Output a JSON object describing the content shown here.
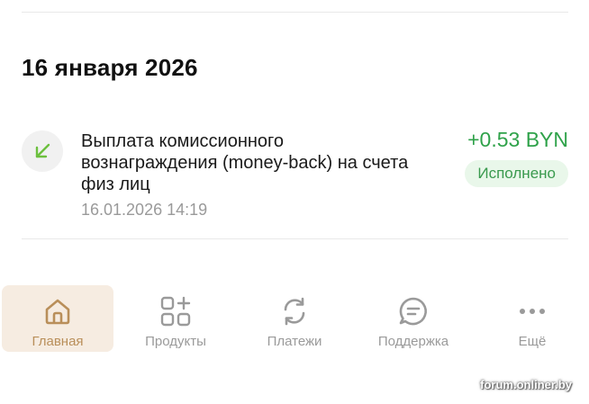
{
  "history": {
    "date_heading": "16 января 2026",
    "transaction": {
      "icon": "arrow-down-left-icon",
      "title": "Выплата комиссионного вознаграждения (money-back) на счета физ лиц",
      "date": "16.01.2026 14:19",
      "amount": "+0.53 BYN",
      "status": "Исполнено"
    }
  },
  "nav": {
    "items": [
      {
        "label": "Главная",
        "icon": "home-icon",
        "active": true
      },
      {
        "label": "Продукты",
        "icon": "grid-plus-icon",
        "active": false
      },
      {
        "label": "Платежи",
        "icon": "refresh-icon",
        "active": false
      },
      {
        "label": "Поддержка",
        "icon": "chat-bubble-icon",
        "active": false
      },
      {
        "label": "Ещё",
        "icon": "more-dots-icon",
        "active": false
      }
    ]
  },
  "watermark": "forum.onliner.by",
  "colors": {
    "positive": "#2fa24a",
    "status_bg": "#e9f7ea",
    "nav_active_bg": "#f6ece1",
    "nav_active": "#b98f5a",
    "muted": "#9a9a9a"
  }
}
